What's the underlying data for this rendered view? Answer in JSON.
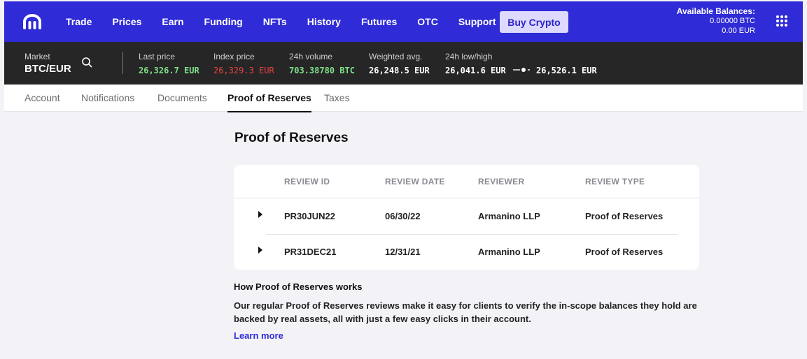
{
  "nav": {
    "items": [
      "Trade",
      "Prices",
      "Earn",
      "Funding",
      "NFTs",
      "History",
      "Futures",
      "OTC",
      "Support"
    ],
    "buy_label": "Buy Crypto",
    "balances_title": "Available Balances:",
    "balance_btc": "0.00000 BTC",
    "balance_eur": "0.00 EUR",
    "brand_color": "#2f2bd6"
  },
  "market": {
    "market_label": "Market",
    "pair": "BTC/EUR",
    "last_price_label": "Last price",
    "last_price": "26,326.7 EUR",
    "index_price_label": "Index price",
    "index_price": "26,329.3 EUR",
    "volume_label": "24h volume",
    "volume": "703.38780 BTC",
    "weighted_label": "Weighted avg.",
    "weighted": "26,248.5 EUR",
    "lowhigh_label": "24h low/high",
    "low": "26,041.6 EUR",
    "high": "26,526.1 EUR",
    "up_color": "#7ee08a",
    "down_color": "#e84242"
  },
  "subtabs": [
    "Account",
    "Notifications",
    "Documents",
    "Proof of Reserves",
    "Taxes"
  ],
  "page": {
    "title": "Proof of Reserves",
    "columns": [
      "REVIEW ID",
      "REVIEW DATE",
      "REVIEWER",
      "REVIEW TYPE"
    ],
    "rows": [
      [
        "PR30JUN22",
        "06/30/22",
        "Armanino LLP",
        "Proof of Reserves"
      ],
      [
        "PR31DEC21",
        "12/31/21",
        "Armanino LLP",
        "Proof of Reserves"
      ]
    ],
    "how_title": "How Proof of Reserves works",
    "how_text": "Our regular Proof of Reserves reviews make it easy for clients to verify the in-scope balances they hold are backed by real assets, all with just a few easy clicks in their account.",
    "learn_more": "Learn more"
  }
}
